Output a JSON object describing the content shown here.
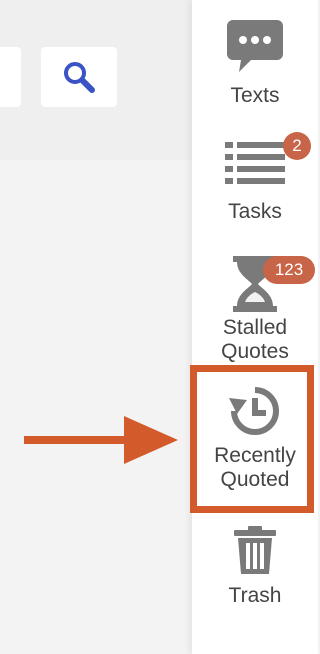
{
  "sidebar": {
    "items": [
      {
        "name": "texts",
        "label": "Texts",
        "icon": "chat-bubble-icon"
      },
      {
        "name": "tasks",
        "label": "Tasks",
        "icon": "list-icon",
        "badge": "2"
      },
      {
        "name": "stalled-quotes",
        "label": "Stalled Quotes",
        "icon": "hourglass-icon",
        "badge": "123"
      },
      {
        "name": "recently-quoted",
        "label": "Recently Quoted",
        "icon": "history-icon"
      },
      {
        "name": "trash",
        "label": "Trash",
        "icon": "trash-icon"
      }
    ]
  },
  "toolbar": {
    "search_icon": "search-icon"
  },
  "colors": {
    "accent": "#3a53c5",
    "badge": "#c86447",
    "annotation": "#d35a2b",
    "icon": "#7a7a7a",
    "text": "#444444"
  }
}
